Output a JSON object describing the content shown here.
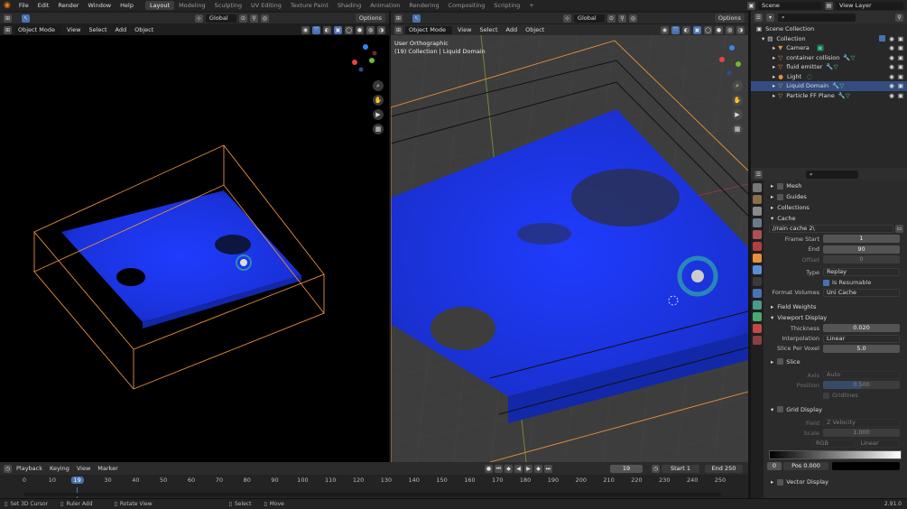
{
  "app": {
    "menus": [
      "File",
      "Edit",
      "Render",
      "Window",
      "Help"
    ]
  },
  "workspaces": [
    "Layout",
    "Modeling",
    "Sculpting",
    "UV Editing",
    "Texture Paint",
    "Shading",
    "Animation",
    "Rendering",
    "Compositing",
    "Scripting"
  ],
  "active_workspace": "Layout",
  "scene": {
    "name": "Scene",
    "view_layer": "View Layer"
  },
  "left_view": {
    "orientation": "Global",
    "options_label": "Options",
    "mode": "Object Mode",
    "menus": [
      "View",
      "Select",
      "Add",
      "Object"
    ]
  },
  "right_view": {
    "orientation": "Global",
    "options_label": "Options",
    "mode": "Object Mode",
    "menus": [
      "View",
      "Select",
      "Add",
      "Object"
    ],
    "info_line1": "User Orthographic",
    "info_line2": "(19) Collection | Liquid Domain"
  },
  "outliner": {
    "root": "Scene Collection",
    "collection": "Collection",
    "items": [
      {
        "name": "Camera",
        "selected": false
      },
      {
        "name": "container collision",
        "selected": false
      },
      {
        "name": "fluid emitter",
        "selected": false
      },
      {
        "name": "Light",
        "selected": false
      },
      {
        "name": "Liquid Domain",
        "selected": true
      },
      {
        "name": "Particle FF Plane",
        "selected": false
      }
    ]
  },
  "properties": {
    "sections_top": [
      "Mesh",
      "Guides",
      "Collections"
    ],
    "cache": {
      "title": "Cache",
      "path": "//rain cache 2\\",
      "frame_start_label": "Frame Start",
      "frame_start": "1",
      "end_label": "End",
      "end": "90",
      "offset_label": "Offset",
      "offset": "0",
      "type_label": "Type",
      "type": "Replay",
      "resumable_label": "Is Resumable",
      "format_label": "Format Volumes",
      "format": "Uni Cache"
    },
    "field_weights": "Field Weights",
    "viewport_display": {
      "title": "Viewport Display",
      "thickness_label": "Thickness",
      "thickness": "0.020",
      "interp_label": "Interpolation",
      "interp": "Linear",
      "slice_label": "Slice Per Voxel",
      "slice": "5.0"
    },
    "slice": {
      "title": "Slice",
      "axis_label": "Axis",
      "axis": "Auto",
      "position_label": "Position",
      "position": "0.500",
      "gridlines_label": "Gridlines"
    },
    "grid_display": {
      "title": "Grid Display",
      "field_label": "Field",
      "field": "Z Velocity",
      "scale_label": "Scale",
      "scale": "1.000",
      "rgb_label": "RGB",
      "interp": "Linear",
      "stop_index": "0",
      "pos_label": "Pos",
      "pos": "0.000"
    },
    "vector_display": "Vector Display"
  },
  "timeline": {
    "menus": [
      "Playback",
      "Keying",
      "View",
      "Marker"
    ],
    "current_frame": "19",
    "start_label": "Start",
    "start": "1",
    "end_label": "End",
    "end": "250",
    "ticks": [
      "0",
      "10",
      "19",
      "30",
      "40",
      "50",
      "60",
      "70",
      "80",
      "90",
      "100",
      "110",
      "120",
      "130",
      "140",
      "150",
      "160",
      "170",
      "180",
      "190",
      "200",
      "210",
      "220",
      "230",
      "240",
      "250"
    ]
  },
  "status": {
    "items": [
      "Set 3D Cursor",
      "Ruler Add",
      "Rotate View",
      "Select",
      "Move"
    ],
    "version": "2.91.0"
  },
  "colors": {
    "accent": "#4772b3",
    "domain_box": "#e8913a",
    "liquid": "#1a3df0",
    "selected_row": "#334d80"
  }
}
